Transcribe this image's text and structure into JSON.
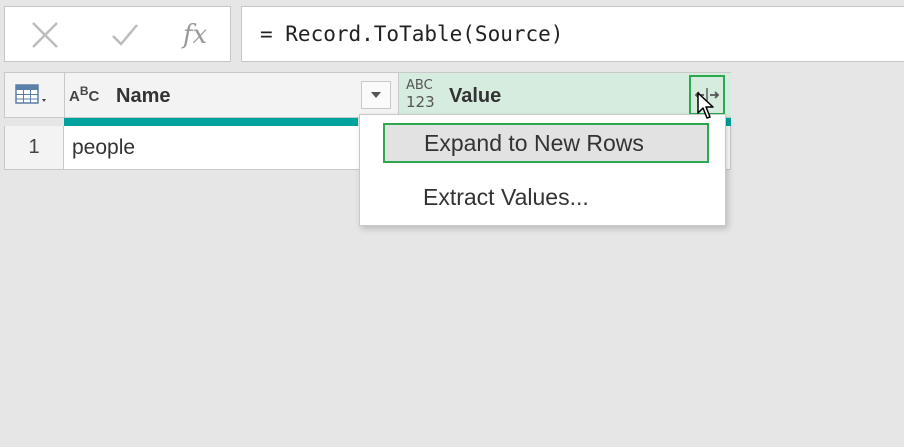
{
  "formula_bar": {
    "cancel_icon": "x-icon",
    "commit_icon": "check-icon",
    "fx_label": "fx",
    "formula": "= Record.ToTable(Source)"
  },
  "table": {
    "columns": [
      {
        "type_icon": "abc-text-type-icon",
        "type_label": "ABC",
        "name": "Name"
      },
      {
        "type_icon": "abc-123-any-type-icon",
        "type_label_top": "ABC",
        "type_label_bottom": "123",
        "name": "Value"
      }
    ],
    "rows": [
      {
        "num": "1",
        "name": "people"
      }
    ]
  },
  "menu": {
    "items": [
      {
        "label": "Expand to New Rows",
        "highlighted": true
      },
      {
        "label": "Extract Values...",
        "highlighted": false
      }
    ]
  },
  "colors": {
    "highlight_border": "#2ea84f",
    "quality_bar": "#00a39e",
    "value_header_bg": "#d6ecdf"
  }
}
